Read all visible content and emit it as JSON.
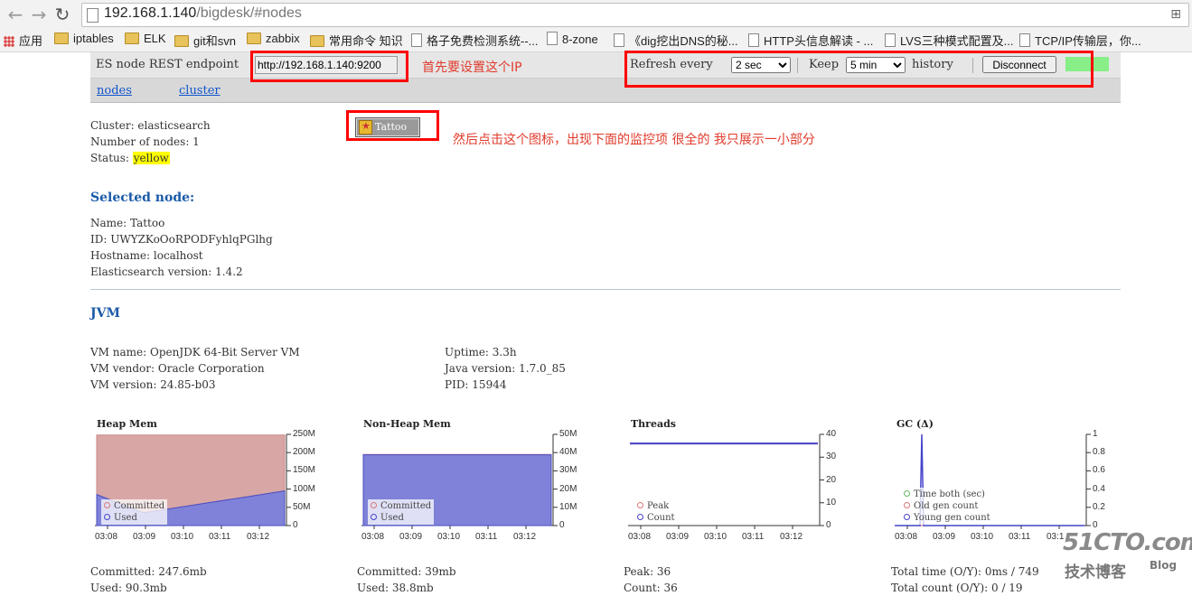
{
  "browser": {
    "url_host": "192.168.1.140",
    "url_path": "/bigdesk/#nodes",
    "bookmarks": [
      "应用",
      "iptables",
      "ELK",
      "git和svn",
      "zabbix",
      "常用命令 知识",
      "格子免费检测系统--...",
      "8-zone",
      "《dig挖出DNS的秘...",
      "HTTP头信息解读 - ...",
      "LVS三种模式配置及...",
      "TCP/IP传输层，你..."
    ]
  },
  "header": {
    "endpoint_label": "ES node REST endpoint",
    "endpoint_value": "http://192.168.1.140:9200",
    "refresh_label": "Refresh every",
    "refresh_value": "2 sec",
    "keep_label": "Keep",
    "keep_value": "5 min",
    "history_label": "history",
    "disconnect_label": "Disconnect",
    "status_color": "#88ee88"
  },
  "nav": {
    "nodes": "nodes",
    "cluster": "cluster"
  },
  "annotations": {
    "set_ip": "首先要设置这个IP",
    "click_icon": "然后点击这个图标，出现下面的监控项  很全的 我只展示一小部分"
  },
  "node_button": "Tattoo",
  "cluster": {
    "line1": "Cluster: elasticsearch",
    "line2": "Number of nodes: 1",
    "status_label": "Status: ",
    "status_value": "yellow"
  },
  "selected": {
    "title": "Selected node:",
    "name": "Name: Tattoo",
    "id": "ID: UWYZKoOoRPODFyhlqPGlhg",
    "hostname": "Hostname: localhost",
    "version": "Elasticsearch version: 1.4.2"
  },
  "jvm": {
    "title": "JVM",
    "vm_name": "VM name: OpenJDK 64-Bit Server VM",
    "vm_vendor": "VM vendor: Oracle Corporation",
    "vm_version": "VM version: 24.85-b03",
    "uptime": "Uptime: 3.3h",
    "java_version": "Java version: 1.7.0_85",
    "pid": "PID: 15944"
  },
  "charts": {
    "heap": {
      "title": "Heap Mem",
      "legend": [
        "Committed",
        "Used"
      ],
      "yticks": [
        "250M",
        "200M",
        "150M",
        "100M",
        "50M",
        "0"
      ],
      "xticks": [
        "03:08",
        "03:09",
        "03:10",
        "03:11",
        "03:12"
      ],
      "committed": "Committed: 247.6mb",
      "used": "Used: 90.3mb",
      "color_committed": "#d9a6a6",
      "color_used": "#7f82d8"
    },
    "nonheap": {
      "title": "Non-Heap Mem",
      "legend": [
        "Committed",
        "Used"
      ],
      "yticks": [
        "50M",
        "40M",
        "30M",
        "20M",
        "10M",
        "0"
      ],
      "xticks": [
        "03:08",
        "03:09",
        "03:10",
        "03:11",
        "03:12"
      ],
      "committed": "Committed: 39mb",
      "used": "Used: 38.8mb"
    },
    "threads": {
      "title": "Threads",
      "legend": [
        "Peak",
        "Count"
      ],
      "yticks": [
        "40",
        "30",
        "20",
        "10",
        "0"
      ],
      "xticks": [
        "03:08",
        "03:09",
        "03:10",
        "03:11",
        "03:12"
      ],
      "peak": "Peak: 36",
      "count": "Count: 36"
    },
    "gc": {
      "title": "GC (Δ)",
      "legend": [
        "Time both (sec)",
        "Old gen count",
        "Young gen count"
      ],
      "yticks": [
        "1",
        "0.8",
        "0.6",
        "0.4",
        "0.2",
        "0"
      ],
      "xticks": [
        "03:08",
        "03:09",
        "03:10",
        "03:11",
        "03:1"
      ],
      "total_time": "Total time (O/Y): 0ms / 749",
      "total_count": "Total count (O/Y): 0 / 19"
    }
  },
  "chart_data": [
    {
      "type": "area",
      "title": "Heap Mem",
      "x": [
        "03:08",
        "03:09",
        "03:10",
        "03:11",
        "03:12"
      ],
      "ylim": [
        0,
        250
      ],
      "series": [
        {
          "name": "Committed",
          "values": [
            248,
            248,
            248,
            248,
            248
          ]
        },
        {
          "name": "Used",
          "values": [
            85,
            35,
            55,
            75,
            95
          ]
        }
      ]
    },
    {
      "type": "area",
      "title": "Non-Heap Mem",
      "x": [
        "03:08",
        "03:09",
        "03:10",
        "03:11",
        "03:12"
      ],
      "ylim": [
        0,
        50
      ],
      "series": [
        {
          "name": "Committed",
          "values": [
            39,
            39,
            39,
            39,
            39
          ]
        },
        {
          "name": "Used",
          "values": [
            38.8,
            38.8,
            38.8,
            38.8,
            38.8
          ]
        }
      ]
    },
    {
      "type": "line",
      "title": "Threads",
      "x": [
        "03:08",
        "03:09",
        "03:10",
        "03:11",
        "03:12"
      ],
      "ylim": [
        0,
        40
      ],
      "series": [
        {
          "name": "Peak",
          "values": [
            36,
            36,
            36,
            36,
            36
          ]
        },
        {
          "name": "Count",
          "values": [
            36,
            36,
            36,
            36,
            36
          ]
        }
      ]
    },
    {
      "type": "line",
      "title": "GC (Δ)",
      "x": [
        "03:08",
        "03:09",
        "03:10",
        "03:11",
        "03:1"
      ],
      "ylim": [
        0,
        1
      ],
      "series": [
        {
          "name": "Time both (sec)",
          "values": [
            0,
            0,
            0,
            0,
            0
          ]
        },
        {
          "name": "Old gen count",
          "values": [
            0,
            0,
            0,
            0,
            0
          ]
        },
        {
          "name": "Young gen count",
          "values": [
            1,
            0,
            0,
            0,
            0
          ]
        }
      ]
    }
  ],
  "watermark": {
    "main": "51CTO.com",
    "sub": "技术博客",
    "blog": "Blog"
  }
}
